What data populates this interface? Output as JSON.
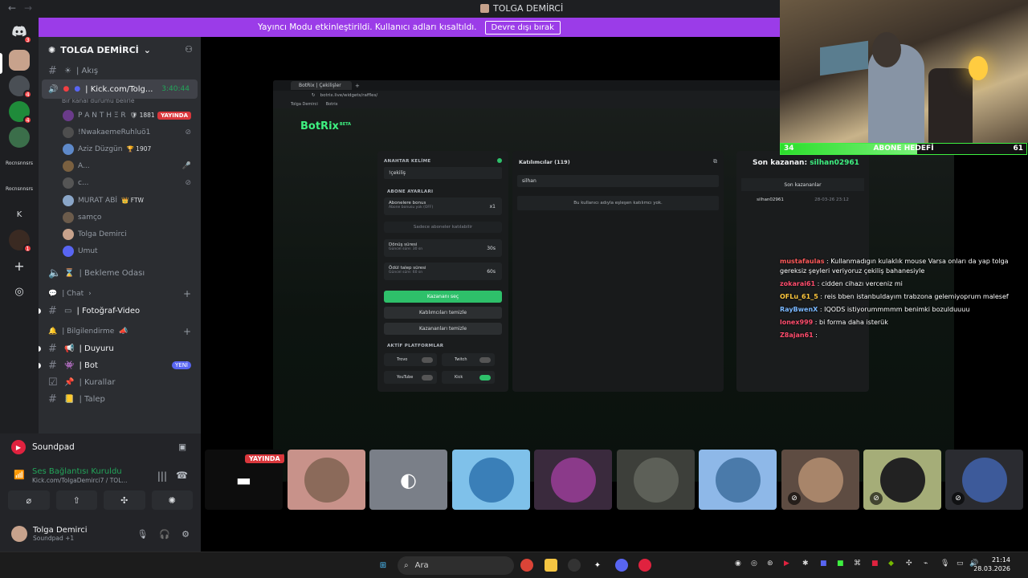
{
  "window": {
    "title": "TOLGA DEMİRCİ"
  },
  "banner": {
    "text": "Yayıncı Modu etkinleştirildi. Kullanıcı adları kısaltıldı.",
    "button": "Devre dışı bırak"
  },
  "rail": {
    "home_badge": "3",
    "badges": [
      "4",
      "4",
      "1",
      "1"
    ],
    "text_servers": [
      "Rocnsnnsrs",
      "Rocnsnnsrs"
    ],
    "letter_server": "K"
  },
  "server": {
    "name": "TOLGA DEMİRCİ"
  },
  "channels": {
    "feed": "| Akış",
    "voice_active": "| Kick.com/Tolg...",
    "voice_time": "3:40:44",
    "voice_status": "Bir kanal durumu belirle",
    "waiting": "| Bekleme Odası",
    "chat_category": "| Chat",
    "photo": "| Fotoğraf-Video",
    "info_category": "| Bilgilendirme",
    "announce": "| Duyuru",
    "bot": "| Bot",
    "new_badge": "YENİ",
    "rules": "| Kurallar",
    "request": "| Talep"
  },
  "members": [
    {
      "name": "P A N T H Ξ R",
      "extra": "🛡 1881",
      "live": "YAYINDA"
    },
    {
      "name": "!NwakaemeRuhluö1",
      "extra": ""
    },
    {
      "name": "Aziz Düzgün",
      "extra": "🏆 1907"
    },
    {
      "name": "A...",
      "extra": ""
    },
    {
      "name": "c...",
      "extra": ""
    },
    {
      "name": "MURAT ABİ",
      "extra": "👑 FTW"
    },
    {
      "name": "samço",
      "extra": ""
    },
    {
      "name": "Tolga Demirci",
      "extra": ""
    },
    {
      "name": "Umut",
      "extra": ""
    }
  ],
  "soundpad": {
    "title": "Soundpad",
    "connection": "Ses Bağlantısı Kuruldu",
    "connection_sub": "Kick.com/TolgaDemirci7 / TOL...",
    "user_name": "Tolga Demirci",
    "user_status": "Soundpad +1"
  },
  "browser": {
    "tab": "BotRix | Çekilişler",
    "url": "botrix.live/widgets/raffles/",
    "bookmarks": [
      "Tolga Demirci",
      "Botrix"
    ],
    "brand": "BotRix",
    "brand_tag": "BETA"
  },
  "raffle": {
    "keyword_label": "ANAHTAR KELİME",
    "keyword_value": "!çekiliş",
    "sub_settings": "ABONE AYARLARI",
    "sub_bonus": "Abonelere bonus",
    "sub_bonus_desc": "Abone bonusu yok (OFF)",
    "sub_bonus_value": "x1",
    "subs_only": "Sadece aboneler katılabilir",
    "duration": "Dönüş süresi",
    "duration_desc": "Güncel süre: 30 sn",
    "duration_value": "30s",
    "claim": "Ödül talep süresi",
    "claim_desc": "Güncel süre: 60 sn",
    "claim_value": "60s",
    "pick_winner": "Kazananı seç",
    "clear_participants": "Katılımcıları temizle",
    "clear_winners": "Kazananları temizle",
    "platforms_label": "AKTİF PLATFORMLAR",
    "platforms": [
      "Trovo",
      "Twitch",
      "YouTube",
      "Kick"
    ],
    "participants_title": "Katılımcılar (119)",
    "participants_search": "silhan",
    "participants_empty": "Bu kullanıcı adıyla eşleşen katılımcı yok.",
    "last_winner_label": "Son kazanan:",
    "last_winner": "silhan02961",
    "winners_title": "Son kazananlar",
    "winner_row_name": "silhan02961",
    "winner_row_date": "28-03-26 23:12"
  },
  "sub_goal": {
    "current": "34",
    "label": "ABONE HEDEFİ",
    "target": "61",
    "progress": 0.557
  },
  "chat": [
    {
      "user": "mustafaulas",
      "color": "#ff5a5a",
      "text": "Kullanmadıgın kulaklık mouse Varsa onları da yap tolga gereksiz şeyleri veriyoruz çekiliş bahanesiyle"
    },
    {
      "user": "zokarai61",
      "color": "#ff4d6d",
      "text": "cidden cihazı verceniz mi"
    },
    {
      "user": "OFLu_61_5",
      "color": "#ffc83d",
      "text": "reis bben istanbuldayım trabzona gelemiyoprum malesef"
    },
    {
      "user": "RayBwenX",
      "color": "#7ab8ff",
      "text": "IQODS istiyorummmmm benimki bozulduuuu"
    },
    {
      "user": "lonex999",
      "color": "#ff4d6d",
      "text": "bi forma daha isterük"
    },
    {
      "user": "Z8ajan61",
      "color": "#ff4d6d",
      "text": ""
    }
  ],
  "stage": {
    "live_tag": "YAYINDA"
  },
  "taskbar": {
    "search": "Ara",
    "time": "21:14",
    "date": "28.03.2026"
  },
  "colors": {
    "brand": "#5865f2",
    "live": "#da373c",
    "online": "#23a55a",
    "streamer_banner": "#9b3ce8",
    "botrix_green": "#3ef080"
  }
}
